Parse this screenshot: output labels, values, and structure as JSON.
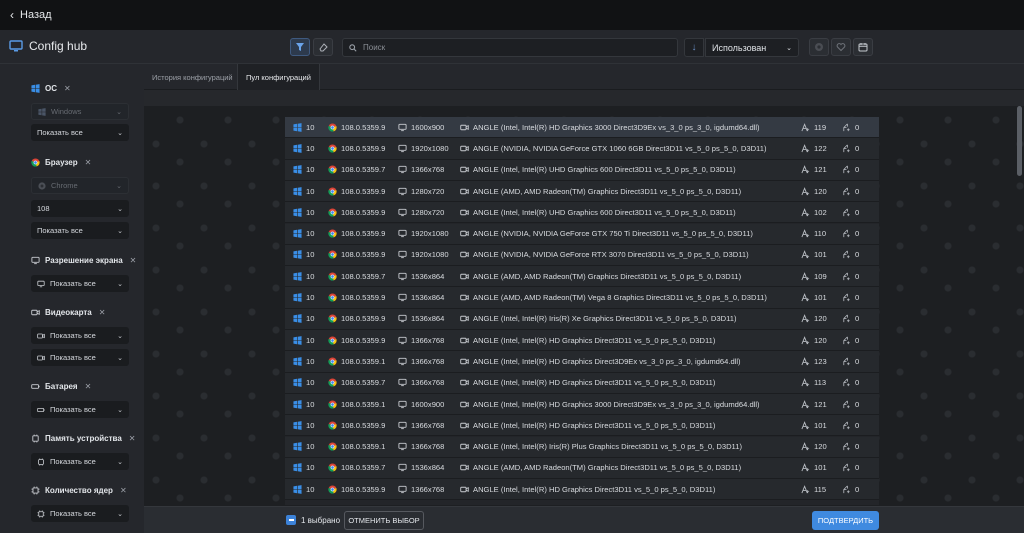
{
  "topbar": {
    "back_label": "Назад"
  },
  "header": {
    "app_title": "Config hub",
    "search_placeholder": "Поиск",
    "sort_value": "Использован"
  },
  "tabs": [
    {
      "label": "История конфигураций",
      "active": false
    },
    {
      "label": "Пул конфигураций",
      "active": true
    }
  ],
  "sidebar": {
    "os": {
      "title": "ОС",
      "select": "Windows",
      "mode": "Показать все"
    },
    "browser": {
      "title": "Браузер",
      "select": "Chrome",
      "version": "108",
      "mode": "Показать все"
    },
    "resolution": {
      "title": "Разрешение экрана",
      "mode": "Показать все"
    },
    "gpu": {
      "title": "Видеокарта",
      "mode1": "Показать все",
      "mode2": "Показать все"
    },
    "battery": {
      "title": "Батарея",
      "mode": "Показать все"
    },
    "memory": {
      "title": "Память устройства",
      "mode": "Показать все"
    },
    "cores": {
      "title": "Количество ядер",
      "mode": "Показать все"
    }
  },
  "rows": [
    {
      "os": "10",
      "browser": "108.0.5359.9",
      "res": "1600x900",
      "gpu": "ANGLE (Intel, Intel(R) HD Graphics 3000 Direct3D9Ex vs_3_0 ps_3_0, igdumd64.dll)",
      "count": "119",
      "used": "0",
      "selected": true
    },
    {
      "os": "10",
      "browser": "108.0.5359.9",
      "res": "1920x1080",
      "gpu": "ANGLE (NVIDIA, NVIDIA GeForce GTX 1060 6GB Direct3D11 vs_5_0 ps_5_0, D3D11)",
      "count": "122",
      "used": "0"
    },
    {
      "os": "10",
      "browser": "108.0.5359.7",
      "res": "1366x768",
      "gpu": "ANGLE (Intel, Intel(R) UHD Graphics 600 Direct3D11 vs_5_0 ps_5_0, D3D11)",
      "count": "121",
      "used": "0"
    },
    {
      "os": "10",
      "browser": "108.0.5359.9",
      "res": "1280x720",
      "gpu": "ANGLE (AMD, AMD Radeon(TM) Graphics Direct3D11 vs_5_0 ps_5_0, D3D11)",
      "count": "120",
      "used": "0"
    },
    {
      "os": "10",
      "browser": "108.0.5359.9",
      "res": "1280x720",
      "gpu": "ANGLE (Intel, Intel(R) UHD Graphics 600 Direct3D11 vs_5_0 ps_5_0, D3D11)",
      "count": "102",
      "used": "0"
    },
    {
      "os": "10",
      "browser": "108.0.5359.9",
      "res": "1920x1080",
      "gpu": "ANGLE (NVIDIA, NVIDIA GeForce GTX 750 Ti Direct3D11 vs_5_0 ps_5_0, D3D11)",
      "count": "110",
      "used": "0"
    },
    {
      "os": "10",
      "browser": "108.0.5359.9",
      "res": "1920x1080",
      "gpu": "ANGLE (NVIDIA, NVIDIA GeForce RTX 3070 Direct3D11 vs_5_0 ps_5_0, D3D11)",
      "count": "101",
      "used": "0"
    },
    {
      "os": "10",
      "browser": "108.0.5359.7",
      "res": "1536x864",
      "gpu": "ANGLE (AMD, AMD Radeon(TM) Graphics Direct3D11 vs_5_0 ps_5_0, D3D11)",
      "count": "109",
      "used": "0"
    },
    {
      "os": "10",
      "browser": "108.0.5359.9",
      "res": "1536x864",
      "gpu": "ANGLE (AMD, AMD Radeon(TM) Vega 8 Graphics Direct3D11 vs_5_0 ps_5_0, D3D11)",
      "count": "101",
      "used": "0"
    },
    {
      "os": "10",
      "browser": "108.0.5359.9",
      "res": "1536x864",
      "gpu": "ANGLE (Intel, Intel(R) Iris(R) Xe Graphics Direct3D11 vs_5_0 ps_5_0, D3D11)",
      "count": "120",
      "used": "0"
    },
    {
      "os": "10",
      "browser": "108.0.5359.9",
      "res": "1366x768",
      "gpu": "ANGLE (Intel, Intel(R) HD Graphics Direct3D11 vs_5_0 ps_5_0, D3D11)",
      "count": "120",
      "used": "0"
    },
    {
      "os": "10",
      "browser": "108.0.5359.1",
      "res": "1366x768",
      "gpu": "ANGLE (Intel, Intel(R) HD Graphics Direct3D9Ex vs_3_0 ps_3_0, igdumd64.dll)",
      "count": "123",
      "used": "0"
    },
    {
      "os": "10",
      "browser": "108.0.5359.7",
      "res": "1366x768",
      "gpu": "ANGLE (Intel, Intel(R) HD Graphics Direct3D11 vs_5_0 ps_5_0, D3D11)",
      "count": "113",
      "used": "0"
    },
    {
      "os": "10",
      "browser": "108.0.5359.1",
      "res": "1600x900",
      "gpu": "ANGLE (Intel, Intel(R) HD Graphics 3000 Direct3D9Ex vs_3_0 ps_3_0, igdumd64.dll)",
      "count": "121",
      "used": "0"
    },
    {
      "os": "10",
      "browser": "108.0.5359.9",
      "res": "1366x768",
      "gpu": "ANGLE (Intel, Intel(R) HD Graphics Direct3D11 vs_5_0 ps_5_0, D3D11)",
      "count": "101",
      "used": "0"
    },
    {
      "os": "10",
      "browser": "108.0.5359.1",
      "res": "1366x768",
      "gpu": "ANGLE (Intel, Intel(R) Iris(R) Plus Graphics Direct3D11 vs_5_0 ps_5_0, D3D11)",
      "count": "120",
      "used": "0"
    },
    {
      "os": "10",
      "browser": "108.0.5359.7",
      "res": "1536x864",
      "gpu": "ANGLE (AMD, AMD Radeon(TM) Graphics Direct3D11 vs_5_0 ps_5_0, D3D11)",
      "count": "101",
      "used": "0"
    },
    {
      "os": "10",
      "browser": "108.0.5359.9",
      "res": "1366x768",
      "gpu": "ANGLE (Intel, Intel(R) HD Graphics Direct3D11 vs_5_0 ps_5_0, D3D11)",
      "count": "115",
      "used": "0"
    }
  ],
  "footer": {
    "selected_label": "1 выбрано",
    "clear_label": "ОТМЕНИТЬ ВЫБОР",
    "confirm_label": "ПОДТВЕРДИТЬ"
  },
  "colors": {
    "accent": "#3f8ae0",
    "windows": "#3a8ee6",
    "bg": "#1e2024"
  }
}
